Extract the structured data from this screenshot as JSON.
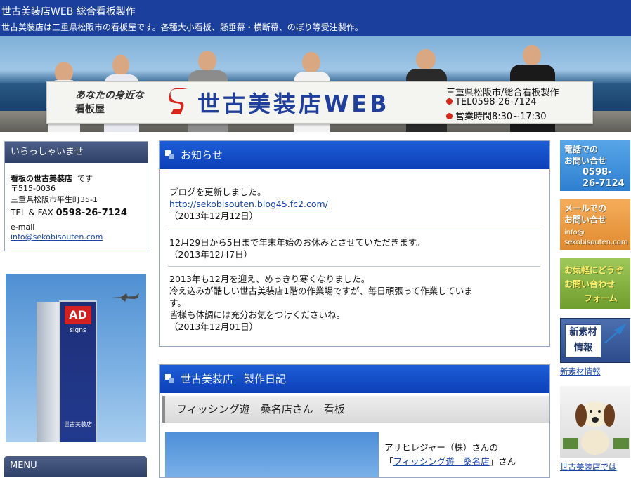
{
  "header": {
    "title": "世古美装店WEB 総合看板製作",
    "tagline": "世古美装店は三重県松阪市の看板屋です。各種大小看板、懸垂幕・横断幕、のぼり等受注製作。"
  },
  "banner": {
    "slogan_line1": "あなたの身近な",
    "slogan_line2": "看板屋",
    "sign_name": "世古美装店WEB",
    "right_line1": "三重県松阪市/総合看板製作",
    "right_line2": "TEL0598-26-7124",
    "right_line3": "営業時間8:30~17:30"
  },
  "welcome": {
    "heading": "いらっしゃいませ",
    "company": "看板の世古美装店",
    "company_suffix": "です",
    "postal": "〒515-0036",
    "address": "三重県松阪市平生町35-1",
    "tel_label": "TEL & FAX",
    "tel": "0598-26-7124",
    "email_label": "e-mail",
    "email": "info@sekobisouten.com"
  },
  "ad_photo": {
    "sign_ad": "AD",
    "sign_signs": "signs",
    "sign_name": "世古美装店"
  },
  "menu": {
    "label": "MENU"
  },
  "news": {
    "heading": "お知らせ",
    "items": [
      {
        "line1": "ブログを更新しました。",
        "link": "http://sekobisouten.blog45.fc2.com/",
        "date": "（2013年12月12日）"
      },
      {
        "line1": "12月29日から5日まで年末年始のお休みとさせていただきます。",
        "date": "（2013年12月7日）"
      },
      {
        "line1": "2013年も12月を迎え、めっきり寒くなりました。",
        "line2": "冷え込みが酷しい世古美装店1階の作業場ですが、毎日頑張って作業していま",
        "line3": "す。",
        "line4": "皆様も体調には充分お気をつけくださいね。",
        "date": "（2013年12月01日）"
      }
    ]
  },
  "diary": {
    "heading": "世古美装店　製作日記",
    "entry_title": "フィッシング遊　桑名店さん　看板",
    "text1": "アサヒレジャー（株）さんの",
    "link_prefix": "「",
    "link": "フィッシング遊　桑名店",
    "link_suffix": "」さん"
  },
  "right": {
    "phone_line1": "電話での",
    "phone_line2": "お問い合せ",
    "phone_number1": "0598-",
    "phone_number2": "26-7124",
    "mail_line1": "メールでの",
    "mail_line2": "お問い合せ",
    "mail_addr1": "info@",
    "mail_addr2": "sekobisouten.com",
    "form_line1": "お気軽にどうぞ",
    "form_line2": "お問い合わせ",
    "form_line3": "フォーム",
    "newmat_icon_text": "新素材情報",
    "newmat_link": "新素材情報",
    "bottom_link": "世古美装店では"
  },
  "colors": {
    "header_blue": "#1a3f9c",
    "panel_blue": "#0c3fb8",
    "link": "#1a45a8"
  }
}
